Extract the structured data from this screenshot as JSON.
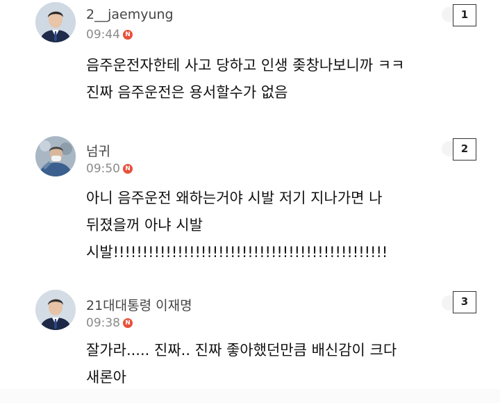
{
  "comments": [
    {
      "username": "2__jaemyung",
      "time": "09:44",
      "new_badge": "N",
      "rank": "1",
      "lines": [
        "음주운전자한테 사고 당하고 인생 좆창나보니까 ㅋㅋ",
        "진짜 음주운전은 용서할수가 없음"
      ]
    },
    {
      "username": "넘귀",
      "time": "09:50",
      "new_badge": "N",
      "rank": "2",
      "lines": [
        "아니 음주운전 왜하는거야 시발 저기 지나가면 나",
        "뒤졌을꺼 아냐 시발",
        "시발!!!!!!!!!!!!!!!!!!!!!!!!!!!!!!!!!!!!!!!!!!!!!!!"
      ]
    },
    {
      "username": "21대대통령 이재명",
      "time": "09:38",
      "new_badge": "N",
      "rank": "3",
      "lines": [
        "잘가라..... 진짜.. 진짜 좋아했던만큼 배신감이 크다",
        "새론아"
      ]
    }
  ],
  "colors": {
    "new_badge": "#e8503a",
    "timestamp": "#8a8a8a",
    "text": "#111111"
  },
  "icons": {
    "avatar_1": "man-in-suit-portrait",
    "avatar_2": "person-with-mask-photo",
    "avatar_3": "man-in-suit-portrait"
  }
}
